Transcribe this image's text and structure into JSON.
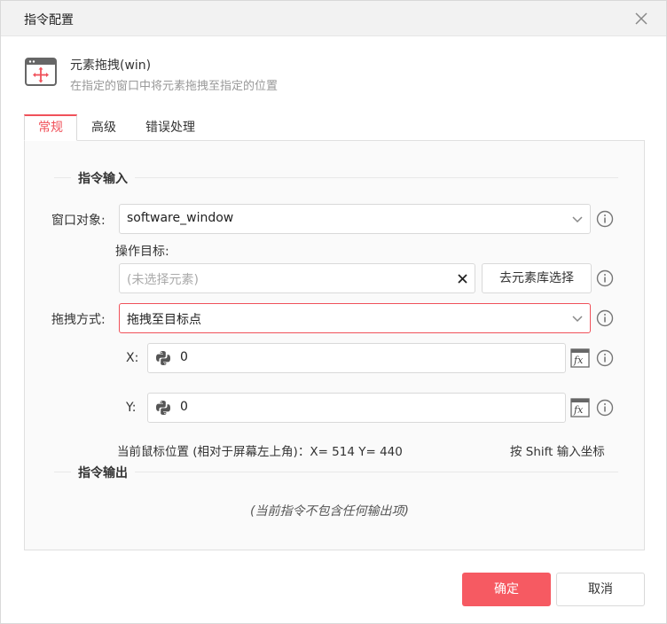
{
  "dialog": {
    "title": "指令配置"
  },
  "command": {
    "name": "元素拖拽(win)",
    "description": "在指定的窗口中将元素拖拽至指定的位置",
    "icon": "move-window-icon"
  },
  "tabs": [
    {
      "label": "常规",
      "active": true
    },
    {
      "label": "高级"
    },
    {
      "label": "错误处理"
    }
  ],
  "input_section": {
    "title": "指令输入"
  },
  "output_section": {
    "title": "指令输出",
    "empty_text": "(当前指令不包含任何输出项)"
  },
  "fields": {
    "window_object": {
      "label": "窗口对象:",
      "value": "software_window"
    },
    "operation_target": {
      "label": "操作目标:",
      "placeholder": "(未选择元素)",
      "library_button": "去元素库选择"
    },
    "drag_mode": {
      "label": "拖拽方式:",
      "value": "拖拽至目标点"
    },
    "x": {
      "label": "X:",
      "value": "0"
    },
    "y": {
      "label": "Y:",
      "value": "0"
    }
  },
  "mouse_position": {
    "text": "当前鼠标位置 (相对于屏幕左上角)：X= 514 Y= 440",
    "hint": "按 Shift 输入坐标"
  },
  "footer": {
    "confirm_label": "确定",
    "cancel_label": "取消"
  },
  "colors": {
    "accent": "#f0515a",
    "confirm_bg": "#f65a62"
  }
}
